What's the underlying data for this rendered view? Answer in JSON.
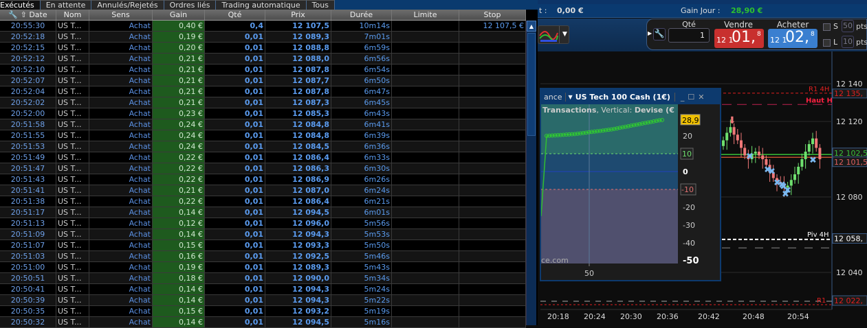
{
  "tabs": [
    {
      "label": "Exécutés"
    },
    {
      "label": "En attente"
    },
    {
      "label": "Annulés/Rejetés"
    },
    {
      "label": "Ordres liés"
    },
    {
      "label": "Trading automatique"
    },
    {
      "label": "Tous"
    }
  ],
  "table": {
    "headers": {
      "date": "Date",
      "nom": "Nom",
      "sens": "Sens",
      "gain": "Gain",
      "qte": "Qté",
      "prix": "Prix",
      "duree": "Durée",
      "limite": "Limite",
      "stop": "Stop"
    },
    "rows": [
      {
        "date": "20:55:30",
        "nom": "US T...",
        "sens": "Achat",
        "gain": "0,40 €",
        "qte": "0,4",
        "prix": "12 107,5",
        "duree": "10m14s",
        "limite": "",
        "stop": "12 107,5 €"
      },
      {
        "date": "20:52:18",
        "nom": "US T...",
        "sens": "Achat",
        "gain": "0,19 €",
        "qte": "0,01",
        "prix": "12 089,3",
        "duree": "7m01s",
        "limite": "",
        "stop": ""
      },
      {
        "date": "20:52:15",
        "nom": "US T...",
        "sens": "Achat",
        "gain": "0,20 €",
        "qte": "0,01",
        "prix": "12 088,8",
        "duree": "6m59s",
        "limite": "",
        "stop": ""
      },
      {
        "date": "20:52:12",
        "nom": "US T...",
        "sens": "Achat",
        "gain": "0,21 €",
        "qte": "0,01",
        "prix": "12 088,0",
        "duree": "6m56s",
        "limite": "",
        "stop": ""
      },
      {
        "date": "20:52:10",
        "nom": "US T...",
        "sens": "Achat",
        "gain": "0,21 €",
        "qte": "0,01",
        "prix": "12 087,8",
        "duree": "6m54s",
        "limite": "",
        "stop": ""
      },
      {
        "date": "20:52:07",
        "nom": "US T...",
        "sens": "Achat",
        "gain": "0,21 €",
        "qte": "0,01",
        "prix": "12 087,7",
        "duree": "6m50s",
        "limite": "",
        "stop": ""
      },
      {
        "date": "20:52:04",
        "nom": "US T...",
        "sens": "Achat",
        "gain": "0,21 €",
        "qte": "0,01",
        "prix": "12 087,8",
        "duree": "6m47s",
        "limite": "",
        "stop": ""
      },
      {
        "date": "20:52:02",
        "nom": "US T...",
        "sens": "Achat",
        "gain": "0,21 €",
        "qte": "0,01",
        "prix": "12 087,3",
        "duree": "6m45s",
        "limite": "",
        "stop": ""
      },
      {
        "date": "20:52:00",
        "nom": "US T...",
        "sens": "Achat",
        "gain": "0,23 €",
        "qte": "0,01",
        "prix": "12 085,3",
        "duree": "6m43s",
        "limite": "",
        "stop": ""
      },
      {
        "date": "20:51:58",
        "nom": "US T...",
        "sens": "Achat",
        "gain": "0,24 €",
        "qte": "0,01",
        "prix": "12 084,8",
        "duree": "6m41s",
        "limite": "",
        "stop": ""
      },
      {
        "date": "20:51:55",
        "nom": "US T...",
        "sens": "Achat",
        "gain": "0,24 €",
        "qte": "0,01",
        "prix": "12 084,8",
        "duree": "6m39s",
        "limite": "",
        "stop": ""
      },
      {
        "date": "20:51:53",
        "nom": "US T...",
        "sens": "Achat",
        "gain": "0,24 €",
        "qte": "0,01",
        "prix": "12 084,5",
        "duree": "6m36s",
        "limite": "",
        "stop": ""
      },
      {
        "date": "20:51:49",
        "nom": "US T...",
        "sens": "Achat",
        "gain": "0,22 €",
        "qte": "0,01",
        "prix": "12 086,4",
        "duree": "6m33s",
        "limite": "",
        "stop": ""
      },
      {
        "date": "20:51:47",
        "nom": "US T...",
        "sens": "Achat",
        "gain": "0,22 €",
        "qte": "0,01",
        "prix": "12 086,3",
        "duree": "6m30s",
        "limite": "",
        "stop": ""
      },
      {
        "date": "20:51:43",
        "nom": "US T...",
        "sens": "Achat",
        "gain": "0,22 €",
        "qte": "0,01",
        "prix": "12 086,9",
        "duree": "6m26s",
        "limite": "",
        "stop": ""
      },
      {
        "date": "20:51:41",
        "nom": "US T...",
        "sens": "Achat",
        "gain": "0,21 €",
        "qte": "0,01",
        "prix": "12 087,0",
        "duree": "6m24s",
        "limite": "",
        "stop": ""
      },
      {
        "date": "20:51:38",
        "nom": "US T...",
        "sens": "Achat",
        "gain": "0,22 €",
        "qte": "0,01",
        "prix": "12 086,4",
        "duree": "6m21s",
        "limite": "",
        "stop": ""
      },
      {
        "date": "20:51:17",
        "nom": "US T...",
        "sens": "Achat",
        "gain": "0,14 €",
        "qte": "0,01",
        "prix": "12 094,5",
        "duree": "6m01s",
        "limite": "",
        "stop": ""
      },
      {
        "date": "20:51:13",
        "nom": "US T...",
        "sens": "Achat",
        "gain": "0,12 €",
        "qte": "0,01",
        "prix": "12 096,0",
        "duree": "5m56s",
        "limite": "",
        "stop": ""
      },
      {
        "date": "20:51:09",
        "nom": "US T...",
        "sens": "Achat",
        "gain": "0,14 €",
        "qte": "0,01",
        "prix": "12 094,3",
        "duree": "5m53s",
        "limite": "",
        "stop": ""
      },
      {
        "date": "20:51:07",
        "nom": "US T...",
        "sens": "Achat",
        "gain": "0,15 €",
        "qte": "0,01",
        "prix": "12 093,3",
        "duree": "5m50s",
        "limite": "",
        "stop": ""
      },
      {
        "date": "20:51:03",
        "nom": "US T...",
        "sens": "Achat",
        "gain": "0,16 €",
        "qte": "0,01",
        "prix": "12 092,5",
        "duree": "5m46s",
        "limite": "",
        "stop": ""
      },
      {
        "date": "20:51:00",
        "nom": "US T...",
        "sens": "Achat",
        "gain": "0,19 €",
        "qte": "0,01",
        "prix": "12 089,3",
        "duree": "5m43s",
        "limite": "",
        "stop": ""
      },
      {
        "date": "20:50:51",
        "nom": "US T...",
        "sens": "Achat",
        "gain": "0,18 €",
        "qte": "0,01",
        "prix": "12 090,0",
        "duree": "5m34s",
        "limite": "",
        "stop": ""
      },
      {
        "date": "20:50:41",
        "nom": "US T...",
        "sens": "Achat",
        "gain": "0,14 €",
        "qte": "0,01",
        "prix": "12 094,3",
        "duree": "5m24s",
        "limite": "",
        "stop": ""
      },
      {
        "date": "20:50:39",
        "nom": "US T...",
        "sens": "Achat",
        "gain": "0,14 €",
        "qte": "0,01",
        "prix": "12 094,3",
        "duree": "5m22s",
        "limite": "",
        "stop": ""
      },
      {
        "date": "20:50:35",
        "nom": "US T...",
        "sens": "Achat",
        "gain": "0,15 €",
        "qte": "0,01",
        "prix": "12 093,2",
        "duree": "5m19s",
        "limite": "",
        "stop": ""
      },
      {
        "date": "20:50:32",
        "nom": "US T...",
        "sens": "Achat",
        "gain": "0,14 €",
        "qte": "0,01",
        "prix": "12 094,5",
        "duree": "5m16s",
        "limite": "",
        "stop": ""
      }
    ]
  },
  "account": {
    "partial_label": "t :",
    "partial_value": "0,00 €",
    "gain_jour_label": "Gain Jour :",
    "gain_jour_value": "28,90 €",
    "gain_color": "#2ec02e"
  },
  "order": {
    "qty_label": "Qté",
    "qty_value": "1",
    "sell_label": "Vendre",
    "sell_prefix": "12 1",
    "sell_big": "01,",
    "sell_sup": "8",
    "buy_label": "Acheter",
    "buy_prefix": "12 1",
    "buy_big": "02,",
    "buy_sup": "8",
    "s_label": "S",
    "s_value": "50",
    "l_label": "L",
    "l_value": "10",
    "pts": "pts",
    "sell_color": "#c8302e",
    "buy_color": "#3a7fd0"
  },
  "popup": {
    "title_left": "ance",
    "instrument": "US Tech 100 Cash (1€)",
    "subtitle_bold": "Transactions",
    "subtitle_mid": ", Vertical: ",
    "subtitle_bold2": "Devise (€",
    "watermark": "ce.com",
    "x_tick": "50",
    "y_ticks": [
      "20",
      "0",
      "-20",
      "-30",
      "-40",
      "-50"
    ],
    "tag_top": "28,9",
    "tag_10": "10",
    "tag_m10": "-10",
    "equity_curve": [
      -25,
      20.0,
      20.1,
      20.2,
      20.3,
      20.4,
      20.5,
      20.6,
      20.7,
      20.8,
      20.9,
      21.0,
      21.2,
      21.4,
      21.6,
      21.8,
      22.0,
      22.2,
      22.4,
      22.6,
      22.8,
      23.0,
      23.2,
      23.4,
      23.6,
      23.9,
      24.2,
      24.5,
      24.8,
      25.1,
      25.4,
      25.7,
      26.0,
      26.3,
      26.6,
      26.9,
      27.2,
      27.5,
      27.8,
      28.1,
      28.4,
      28.7,
      28.9
    ]
  },
  "price_chart": {
    "price_ticks": [
      "12 140",
      "12 120",
      "12 080",
      "12 040"
    ],
    "time_ticks": [
      "20:18",
      "20:24",
      "20:30",
      "20:36",
      "20:42",
      "20:48",
      "20:54"
    ],
    "levels": [
      {
        "label": "R1 4H",
        "value": "12 135,"
      },
      {
        "label": "Haut H",
        "value": ""
      },
      {
        "label": "",
        "value": "12 102,5"
      },
      {
        "label": "",
        "value": "12 101,5"
      },
      {
        "label": "Piv 4H",
        "value": "12 058,"
      },
      {
        "label": "R1",
        "value": "12 022,"
      }
    ],
    "closes": [
      12110,
      12114,
      12117,
      12113,
      12110,
      12106,
      12102,
      12100,
      12103,
      12104,
      12102,
      12100,
      12097,
      12093,
      12090,
      12088,
      12087,
      12085,
      12086,
      12089,
      12092,
      12096,
      12100,
      12104,
      12108,
      12111,
      12106,
      12100
    ]
  }
}
